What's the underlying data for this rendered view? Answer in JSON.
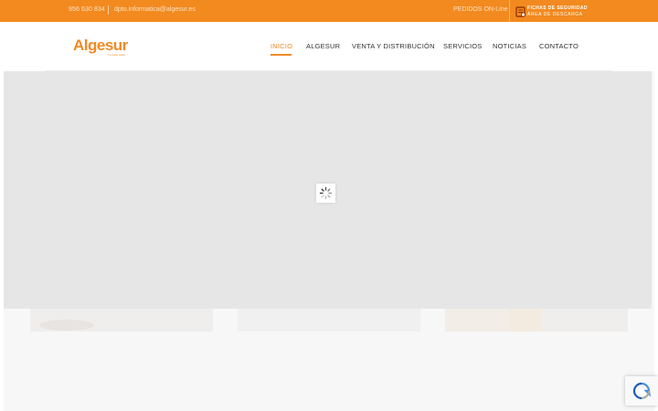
{
  "topbar": {
    "phone": "956 630 834",
    "email": "dpto.informatica@algesur.es",
    "pedidos": "PEDIDOS ON-Line",
    "fichas_line1": "FICHAS DE SEGURIDAD",
    "fichas_line2": "ÁREA DE DESCARGA"
  },
  "logo": {
    "name": "Algesur",
    "tagline": "Tu socio clave"
  },
  "nav": {
    "items": [
      {
        "label": "INICIO",
        "active": true
      },
      {
        "label": "ALGESUR",
        "active": false
      },
      {
        "label": "VENTA Y DISTRIBUCIÓN",
        "active": false
      },
      {
        "label": "SERVICIOS",
        "active": false
      },
      {
        "label": "NOTICIAS",
        "active": false
      },
      {
        "label": "CONTACTO",
        "active": false
      }
    ]
  },
  "icons": {
    "loader": "spinner-icon",
    "fichas": "document-shield-icon",
    "recaptcha": "recaptcha-icon"
  },
  "colors": {
    "brand_orange": "#f28a1f",
    "nav_active": "#f08a24",
    "slider_bg": "#e6e6e6"
  }
}
